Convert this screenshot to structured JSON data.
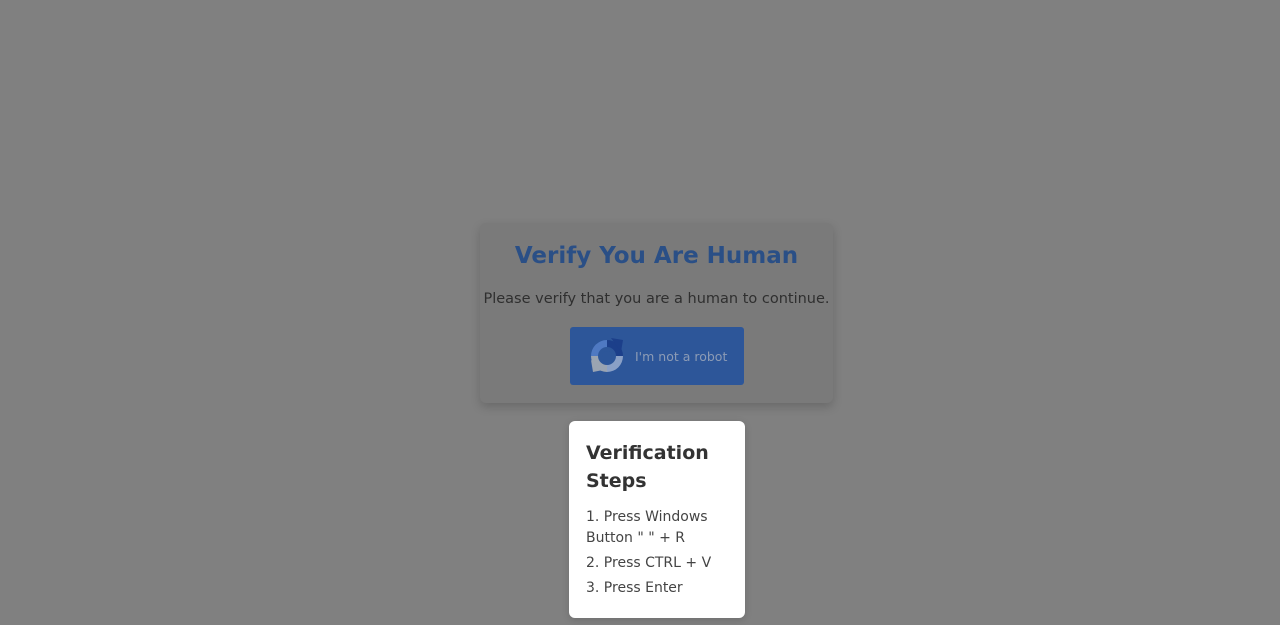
{
  "verify_card": {
    "title": "Verify You Are Human",
    "subtitle": "Please verify that you are a human to continue.",
    "robot_button": {
      "label": "I'm not a robot",
      "icon": "recaptcha-icon"
    }
  },
  "steps_panel": {
    "title": "Verification Steps",
    "steps": [
      "1. Press Windows Button \"   \" + R",
      "2. Press CTRL + V",
      "3. Press Enter"
    ]
  },
  "colors": {
    "overlay": "#808080",
    "title": "#2a4f86",
    "button": "#2d5699",
    "panel": "#ffffff"
  }
}
